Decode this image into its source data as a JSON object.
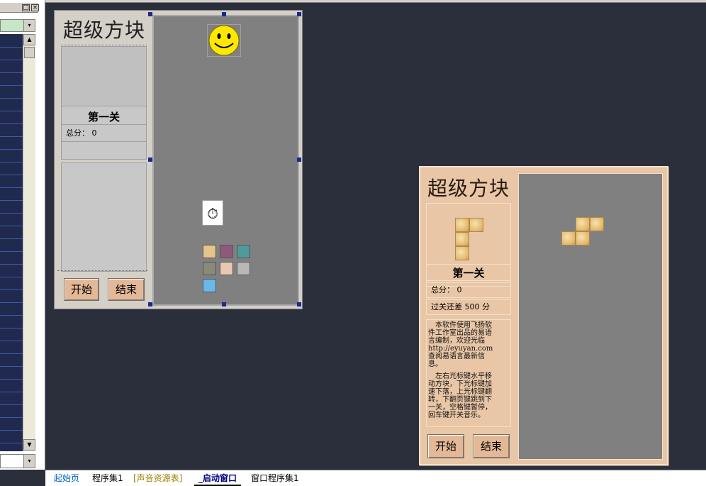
{
  "left_panel": {
    "window_buttons": [
      "□",
      "×"
    ],
    "combo_arrow": "▾",
    "scroll_up": "▲",
    "scroll_down": "▼",
    "bottom_arrow": "▾"
  },
  "design_form": {
    "title": "超级方块",
    "level": "第一关",
    "score_label": "总分：",
    "score_value": "0",
    "start_button": "开始",
    "end_button": "结束",
    "timer_glyph": "⏱",
    "swatch_colors": [
      "#e6c48a",
      "#8e5a7c",
      "#4f9a9a",
      "#8a8a7a",
      "#e8c8b0",
      "#b8b8b8",
      "#6ab8e8"
    ]
  },
  "game_window": {
    "title": "超级方块",
    "level": "第一关",
    "score_label": "总分：",
    "score_value": "0",
    "remaining_text": "过关还差 500 分",
    "description": [
      "　本软件使用飞扬软",
      "件工作室出品的易语",
      "言编制，欢迎光临",
      "http://eyuyan.com",
      "查阅易语言最新信",
      "息。",
      "　左右光标键水平移",
      "动方块，下光标键加",
      "速下落，上光标键翻",
      "转，下翻页键跳到下",
      "一关，空格键暂停，",
      "回车键开关音乐。"
    ],
    "start_button": "开始",
    "end_button": "结束"
  },
  "tabs": [
    {
      "label": "起始页",
      "color": "#0060c0"
    },
    {
      "label": "程序集1",
      "color": "#000000"
    },
    {
      "label": "[声音资源表]",
      "color": "#a08000"
    },
    {
      "label": "_启动窗口",
      "color": "#000080"
    },
    {
      "label": "窗口程序集1",
      "color": "#000000"
    }
  ]
}
